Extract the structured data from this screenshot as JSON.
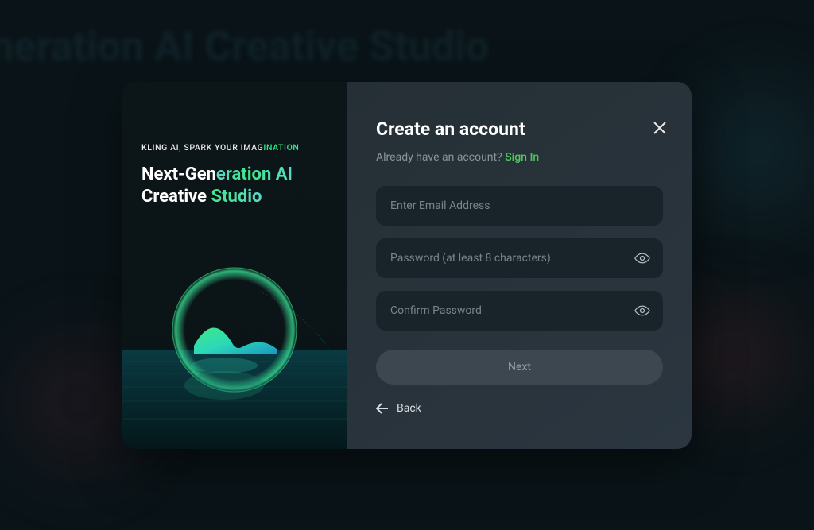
{
  "backdrop": {
    "headline": "eneration AI Creative Studio"
  },
  "left": {
    "tagline_brand": "KLING AI,",
    "tagline_plain": " SPARK YOUR IMAG",
    "tagline_accent": "INATION",
    "headline_l1_plain": "Next-Gen",
    "headline_l1_accent": "eration AI",
    "headline_l2_plain": "Creative ",
    "headline_l2_accent": "Studio"
  },
  "right": {
    "title": "Create an account",
    "sub_text": "Already have an account?  ",
    "sign_in": "Sign In",
    "email_placeholder": "Enter Email Address",
    "password_placeholder": "Password (at least 8 characters)",
    "confirm_placeholder": "Confirm Password",
    "next_label": "Next",
    "back_label": "Back"
  }
}
